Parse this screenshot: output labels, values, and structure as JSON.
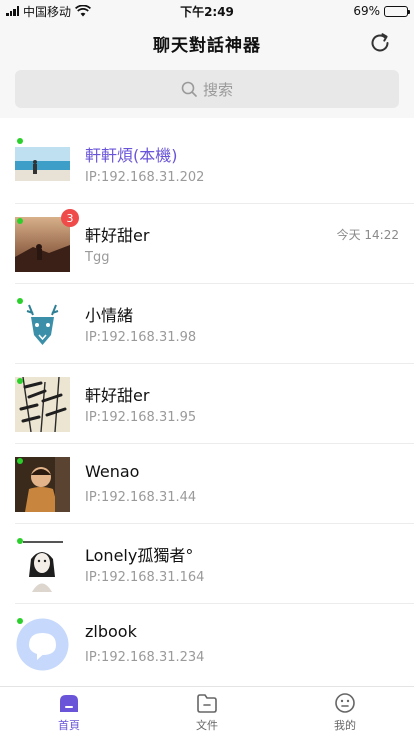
{
  "status_bar": {
    "carrier": "中国移动",
    "time": "下午2:49",
    "battery": "69%",
    "battery_level": 0.69
  },
  "header": {
    "title": "聊天對話神器",
    "refresh_icon": "refresh-icon"
  },
  "search": {
    "placeholder": "搜索",
    "icon": "search-icon"
  },
  "contacts": [
    {
      "name": "軒軒煩(本機)",
      "subtitle": "IP:192.168.31.202",
      "online": true,
      "self": true,
      "avatar": "beach-photo"
    },
    {
      "name": "軒好甜er",
      "subtitle": "Tgg",
      "time": "今天 14:22",
      "unread": "3",
      "online": true,
      "avatar": "sunset-photo"
    },
    {
      "name": "小情緒",
      "subtitle": "IP:192.168.31.98",
      "online": true,
      "avatar": "wolf-drawing"
    },
    {
      "name": "軒好甜er",
      "subtitle": "IP:192.168.31.95",
      "online": true,
      "avatar": "bamboo-painting"
    },
    {
      "name": "Wenao",
      "subtitle": "IP:192.168.31.44",
      "online": true,
      "avatar": "child-photo"
    },
    {
      "name": "Lonely孤獨者°",
      "subtitle": "IP:192.168.31.164",
      "online": true,
      "avatar": "girl-sketch"
    },
    {
      "name": "zlbook",
      "subtitle": "IP:192.168.31.234",
      "online": true,
      "avatar": "default-avatar"
    }
  ],
  "tabs": [
    {
      "label": "首頁",
      "icon": "home-icon",
      "active": true
    },
    {
      "label": "文件",
      "icon": "folder-icon",
      "active": false
    },
    {
      "label": "我的",
      "icon": "profile-icon",
      "active": false
    }
  ],
  "colors": {
    "accent": "#6a55d8",
    "online": "#2ad12a",
    "badge": "#ef4b4b"
  }
}
